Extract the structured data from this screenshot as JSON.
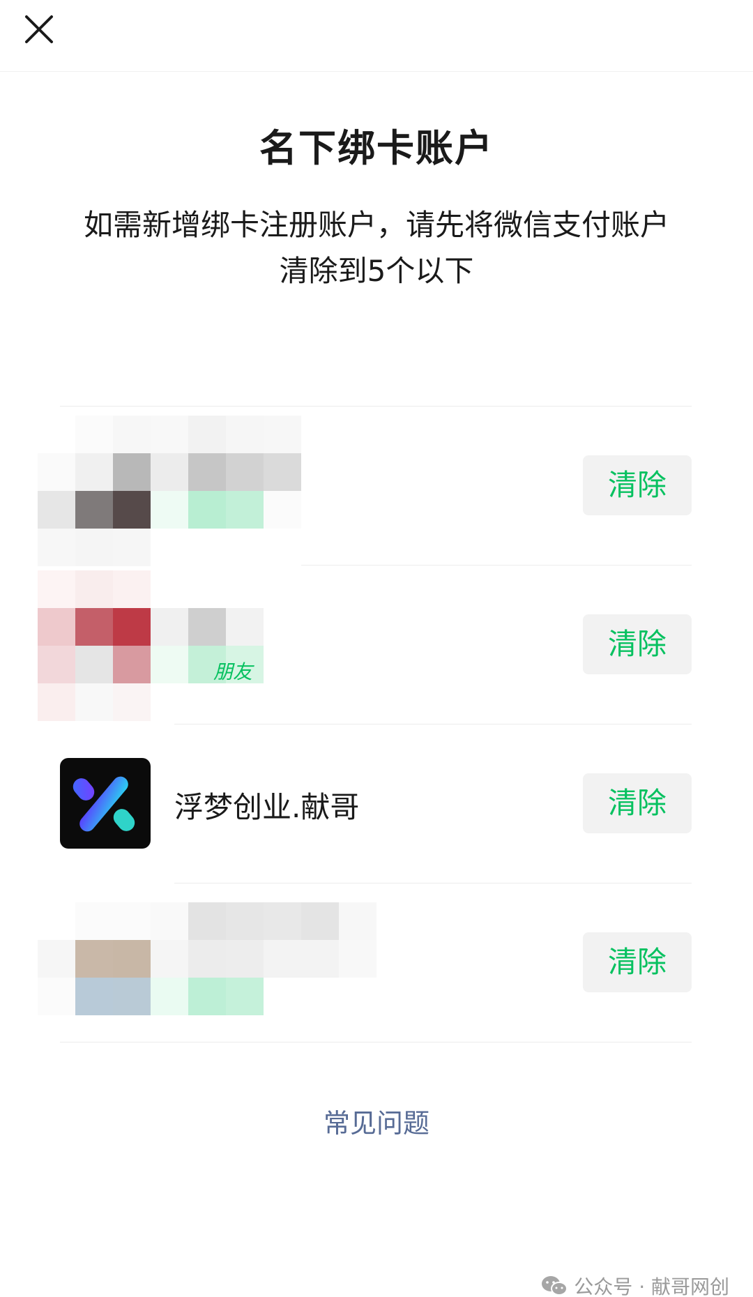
{
  "header": {
    "close_icon": "close-icon"
  },
  "title": "名下绑卡账户",
  "subtitle": "如需新增绑卡注册账户，请先将微信支付账户清除到5个以下",
  "accounts": [
    {
      "name": "",
      "clear_label": "清除"
    },
    {
      "name": "",
      "clear_label": "清除",
      "partial_label": "朋友"
    },
    {
      "name": "浮梦创业.献哥",
      "clear_label": "清除",
      "logo_icon": "x-logo-icon"
    },
    {
      "name": "",
      "clear_label": "清除"
    }
  ],
  "faq_label": "常见问题",
  "watermark": {
    "icon": "wechat-icon",
    "text": "公众号 · 献哥网创"
  },
  "colors": {
    "accent_green": "#07c160",
    "link_blue": "#576b95",
    "button_bg": "#f2f2f2"
  }
}
